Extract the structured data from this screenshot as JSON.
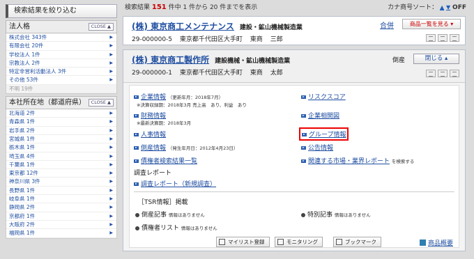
{
  "sidebar": {
    "header": "検索結果を絞り込む",
    "close_label": "CLOSE ▲",
    "section1": {
      "title": "法人格",
      "items": [
        {
          "label": "株式会社 343件",
          "enabled": true
        },
        {
          "label": "有限会社 20件",
          "enabled": true
        },
        {
          "label": "学校法人 1件",
          "enabled": true
        },
        {
          "label": "宗教法人 2件",
          "enabled": true
        },
        {
          "label": "特定非営利活動法人 3件",
          "enabled": true
        },
        {
          "label": "その他 53件",
          "enabled": true
        },
        {
          "label": "不明 19件",
          "enabled": false
        }
      ]
    },
    "section2": {
      "title": "本社所在地（都道府県）",
      "items": [
        {
          "label": "北海道 2件"
        },
        {
          "label": "青森県 1件"
        },
        {
          "label": "岩手県 2件"
        },
        {
          "label": "宮城県 1件"
        },
        {
          "label": "栃木県 1件"
        },
        {
          "label": "埼玉県 4件"
        },
        {
          "label": "千葉県 1件"
        },
        {
          "label": "東京都 12件"
        },
        {
          "label": "神奈川県 3件"
        },
        {
          "label": "長野県 1件"
        },
        {
          "label": "岐阜県 1件"
        },
        {
          "label": "静岡県 2件"
        },
        {
          "label": "京都府 1件"
        },
        {
          "label": "大阪府 2件"
        },
        {
          "label": "福岡県 1件"
        }
      ]
    }
  },
  "results": {
    "prefix": "検索結果",
    "count": "151",
    "suffix": "件中 1 件から 20 件までを表示",
    "sort_label": "カナ商号ソート：",
    "sort_up": "▲",
    "sort_down": "▼",
    "sort_state": "OFF"
  },
  "card1": {
    "name": "(株) 東京商工メンテナンス",
    "category": "建設・鉱山機械製造業",
    "code": "29-000000-5",
    "address": "東京都千代田区大手町",
    "company_short": "東商",
    "person": "三郎",
    "merge_link": "合併",
    "product_button": "商品一覧を見る ▾"
  },
  "card2": {
    "name": "(株) 東京商工製作所",
    "category": "建設機械・鉱山機械製造業",
    "code": "29-000000-1",
    "address": "東京都千代田区大手町",
    "company_short": "東商",
    "person": "太郎",
    "status": "倒産",
    "close_button": "閉じる ▴",
    "links": {
      "company_info": "企業情報",
      "company_info_date": "（更新年月：2018年7月）",
      "company_info_note": "※決算収録期：2018年3月 売上高　あり、利益　あり",
      "financial_info": "財務情報",
      "financial_info_note": "※最新決算期：2018年3月",
      "hr_info": "人事情報",
      "bankruptcy_info": "倒産情報",
      "bankruptcy_date": "（発生年月日：2012年4月23日）",
      "creditor_list": "債権者検索結果一覧",
      "risk_score": "リスクスコア",
      "corporate_group": "企業相関図",
      "group_info": "グループ情報",
      "public_info": "公告情報",
      "market_report": "関連する市場・業界レポート",
      "market_report_suffix": "を検索する"
    },
    "research_title": "調査レポート",
    "research_link": "調査レポート（新規調査）",
    "tsr": {
      "title": "［TSR情報］掲載",
      "bankruptcy_article": "倒産記事",
      "bankruptcy_article_note": "情報はありません",
      "special_article": "特別記事",
      "special_article_note": "情報はありません",
      "creditor_list": "債権者リスト",
      "creditor_list_note": "情報はありません"
    },
    "buttons": {
      "mylist": "マイリスト登録",
      "monitoring": "モニタリング",
      "bookmark": "ブックマーク",
      "overview": "商品概要"
    }
  }
}
